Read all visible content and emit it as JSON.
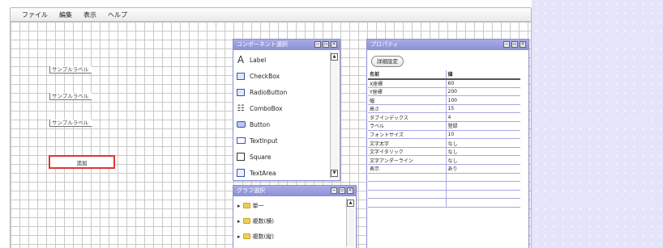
{
  "menu": [
    "ファイル",
    "編集",
    "表示",
    "ヘルプ"
  ],
  "canvas": {
    "sample_labels": [
      "サンプルラベル",
      "サンプルラベル",
      "サンプルラベル"
    ],
    "add_button_label": "追加"
  },
  "component_panel": {
    "title": "コンポーネント選択",
    "items": [
      {
        "label": "Label",
        "icon": "text-a-icon"
      },
      {
        "label": "CheckBox",
        "icon": "checkbox-icon"
      },
      {
        "label": "RadioButton",
        "icon": "radio-icon"
      },
      {
        "label": "ComboBox",
        "icon": "combobox-icon"
      },
      {
        "label": "Button",
        "icon": "button-icon"
      },
      {
        "label": "TextInput",
        "icon": "textinput-icon"
      },
      {
        "label": "Square",
        "icon": "square-icon"
      },
      {
        "label": "TextArea",
        "icon": "textarea-icon"
      }
    ]
  },
  "graph_panel": {
    "title": "グラフ選択",
    "items": [
      "単一",
      "複数(横)",
      "複数(縦)"
    ]
  },
  "property_panel": {
    "title": "プロパティ",
    "detail_button": "詳細設定",
    "headers": [
      "名前",
      "値"
    ],
    "rows": [
      [
        "X座標",
        "60"
      ],
      [
        "Y座標",
        "200"
      ],
      [
        "幅",
        "100"
      ],
      [
        "高さ",
        "15"
      ],
      [
        "タブインデックス",
        "4"
      ],
      [
        "ラベル",
        "登録"
      ],
      [
        "フォントサイズ",
        "10"
      ],
      [
        "文字太字",
        "なし"
      ],
      [
        "文字イタリック",
        "なし"
      ],
      [
        "文字アンダーライン",
        "なし"
      ],
      [
        "表示",
        "あり"
      ],
      [
        "",
        ""
      ],
      [
        "",
        ""
      ],
      [
        "",
        ""
      ],
      [
        "",
        ""
      ]
    ]
  },
  "colors": {
    "panel_title": "#8b90d6",
    "selection_border": "#e03535",
    "background": "#e4e4fa"
  }
}
